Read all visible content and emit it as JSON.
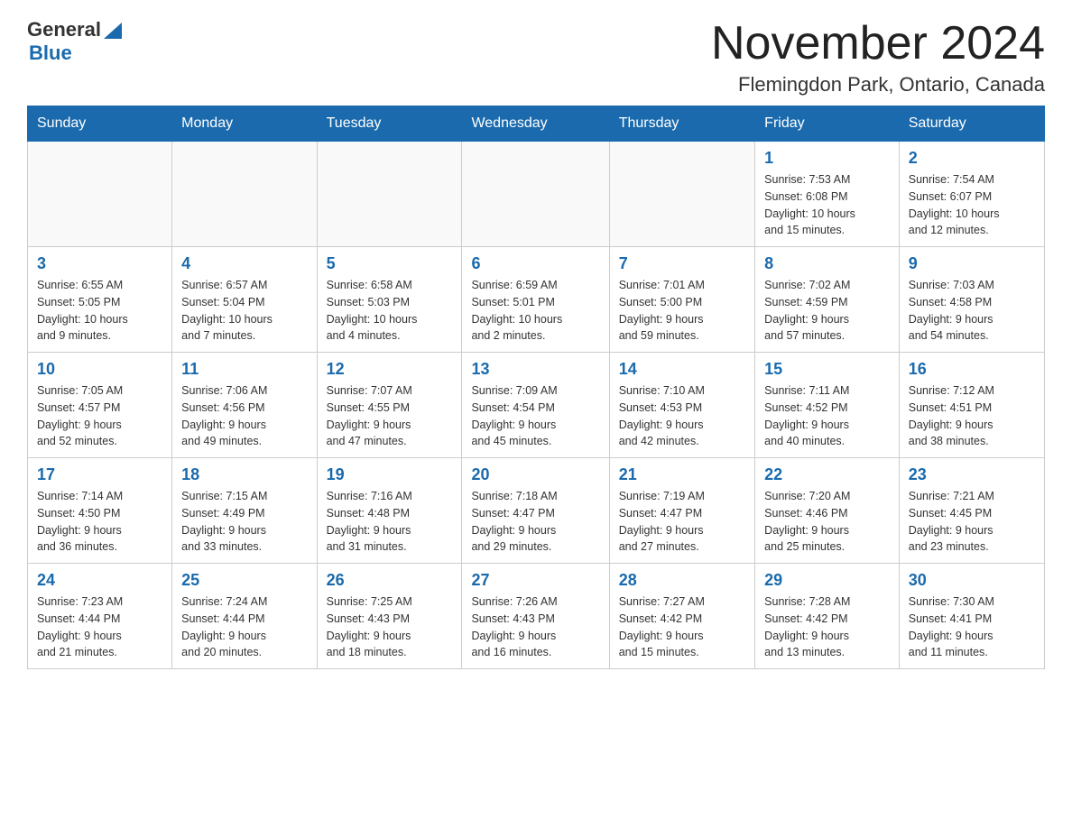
{
  "header": {
    "logo_general": "General",
    "logo_blue": "Blue",
    "month_title": "November 2024",
    "location": "Flemingdon Park, Ontario, Canada"
  },
  "weekdays": [
    "Sunday",
    "Monday",
    "Tuesday",
    "Wednesday",
    "Thursday",
    "Friday",
    "Saturday"
  ],
  "weeks": [
    [
      {
        "day": "",
        "info": ""
      },
      {
        "day": "",
        "info": ""
      },
      {
        "day": "",
        "info": ""
      },
      {
        "day": "",
        "info": ""
      },
      {
        "day": "",
        "info": ""
      },
      {
        "day": "1",
        "info": "Sunrise: 7:53 AM\nSunset: 6:08 PM\nDaylight: 10 hours\nand 15 minutes."
      },
      {
        "day": "2",
        "info": "Sunrise: 7:54 AM\nSunset: 6:07 PM\nDaylight: 10 hours\nand 12 minutes."
      }
    ],
    [
      {
        "day": "3",
        "info": "Sunrise: 6:55 AM\nSunset: 5:05 PM\nDaylight: 10 hours\nand 9 minutes."
      },
      {
        "day": "4",
        "info": "Sunrise: 6:57 AM\nSunset: 5:04 PM\nDaylight: 10 hours\nand 7 minutes."
      },
      {
        "day": "5",
        "info": "Sunrise: 6:58 AM\nSunset: 5:03 PM\nDaylight: 10 hours\nand 4 minutes."
      },
      {
        "day": "6",
        "info": "Sunrise: 6:59 AM\nSunset: 5:01 PM\nDaylight: 10 hours\nand 2 minutes."
      },
      {
        "day": "7",
        "info": "Sunrise: 7:01 AM\nSunset: 5:00 PM\nDaylight: 9 hours\nand 59 minutes."
      },
      {
        "day": "8",
        "info": "Sunrise: 7:02 AM\nSunset: 4:59 PM\nDaylight: 9 hours\nand 57 minutes."
      },
      {
        "day": "9",
        "info": "Sunrise: 7:03 AM\nSunset: 4:58 PM\nDaylight: 9 hours\nand 54 minutes."
      }
    ],
    [
      {
        "day": "10",
        "info": "Sunrise: 7:05 AM\nSunset: 4:57 PM\nDaylight: 9 hours\nand 52 minutes."
      },
      {
        "day": "11",
        "info": "Sunrise: 7:06 AM\nSunset: 4:56 PM\nDaylight: 9 hours\nand 49 minutes."
      },
      {
        "day": "12",
        "info": "Sunrise: 7:07 AM\nSunset: 4:55 PM\nDaylight: 9 hours\nand 47 minutes."
      },
      {
        "day": "13",
        "info": "Sunrise: 7:09 AM\nSunset: 4:54 PM\nDaylight: 9 hours\nand 45 minutes."
      },
      {
        "day": "14",
        "info": "Sunrise: 7:10 AM\nSunset: 4:53 PM\nDaylight: 9 hours\nand 42 minutes."
      },
      {
        "day": "15",
        "info": "Sunrise: 7:11 AM\nSunset: 4:52 PM\nDaylight: 9 hours\nand 40 minutes."
      },
      {
        "day": "16",
        "info": "Sunrise: 7:12 AM\nSunset: 4:51 PM\nDaylight: 9 hours\nand 38 minutes."
      }
    ],
    [
      {
        "day": "17",
        "info": "Sunrise: 7:14 AM\nSunset: 4:50 PM\nDaylight: 9 hours\nand 36 minutes."
      },
      {
        "day": "18",
        "info": "Sunrise: 7:15 AM\nSunset: 4:49 PM\nDaylight: 9 hours\nand 33 minutes."
      },
      {
        "day": "19",
        "info": "Sunrise: 7:16 AM\nSunset: 4:48 PM\nDaylight: 9 hours\nand 31 minutes."
      },
      {
        "day": "20",
        "info": "Sunrise: 7:18 AM\nSunset: 4:47 PM\nDaylight: 9 hours\nand 29 minutes."
      },
      {
        "day": "21",
        "info": "Sunrise: 7:19 AM\nSunset: 4:47 PM\nDaylight: 9 hours\nand 27 minutes."
      },
      {
        "day": "22",
        "info": "Sunrise: 7:20 AM\nSunset: 4:46 PM\nDaylight: 9 hours\nand 25 minutes."
      },
      {
        "day": "23",
        "info": "Sunrise: 7:21 AM\nSunset: 4:45 PM\nDaylight: 9 hours\nand 23 minutes."
      }
    ],
    [
      {
        "day": "24",
        "info": "Sunrise: 7:23 AM\nSunset: 4:44 PM\nDaylight: 9 hours\nand 21 minutes."
      },
      {
        "day": "25",
        "info": "Sunrise: 7:24 AM\nSunset: 4:44 PM\nDaylight: 9 hours\nand 20 minutes."
      },
      {
        "day": "26",
        "info": "Sunrise: 7:25 AM\nSunset: 4:43 PM\nDaylight: 9 hours\nand 18 minutes."
      },
      {
        "day": "27",
        "info": "Sunrise: 7:26 AM\nSunset: 4:43 PM\nDaylight: 9 hours\nand 16 minutes."
      },
      {
        "day": "28",
        "info": "Sunrise: 7:27 AM\nSunset: 4:42 PM\nDaylight: 9 hours\nand 15 minutes."
      },
      {
        "day": "29",
        "info": "Sunrise: 7:28 AM\nSunset: 4:42 PM\nDaylight: 9 hours\nand 13 minutes."
      },
      {
        "day": "30",
        "info": "Sunrise: 7:30 AM\nSunset: 4:41 PM\nDaylight: 9 hours\nand 11 minutes."
      }
    ]
  ]
}
